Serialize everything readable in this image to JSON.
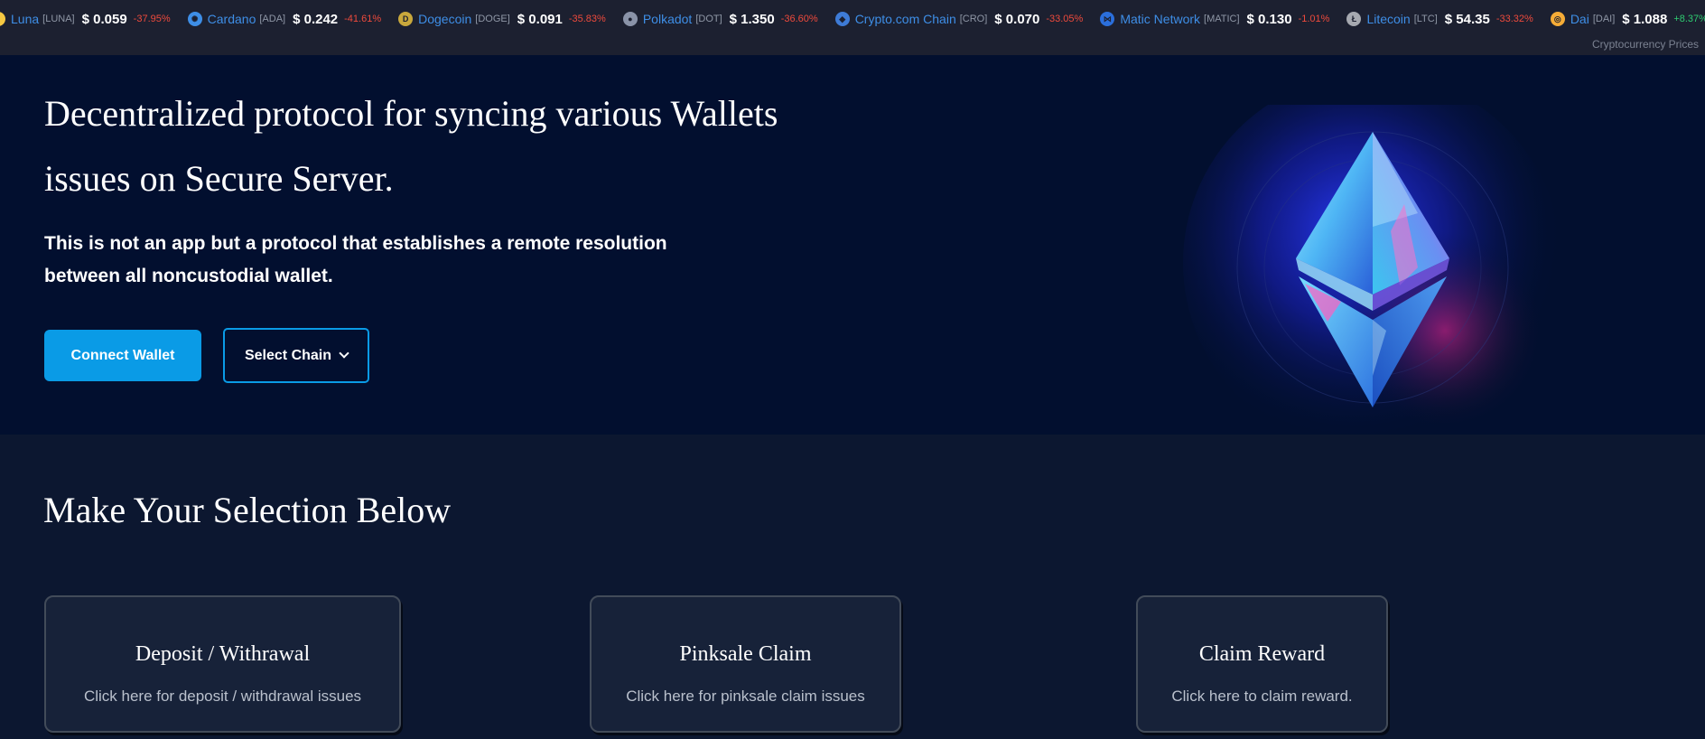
{
  "ticker": {
    "items": [
      {
        "name": "Luna",
        "symbol": "[LUNA]",
        "price": "$ 0.059",
        "change": "-37.95%",
        "dir": "neg",
        "icon": "luna-logo-icon",
        "color": "#f5c842",
        "glyph": ""
      },
      {
        "name": "Cardano",
        "symbol": "[ADA]",
        "price": "$ 0.242",
        "change": "-41.61%",
        "dir": "neg",
        "icon": "cardano-logo-icon",
        "color": "#3e8ee6",
        "glyph": "✺"
      },
      {
        "name": "Dogecoin",
        "symbol": "[DOGE]",
        "price": "$ 0.091",
        "change": "-35.83%",
        "dir": "neg",
        "icon": "dogecoin-logo-icon",
        "color": "#c9a83c",
        "glyph": "D"
      },
      {
        "name": "Polkadot",
        "symbol": "[DOT]",
        "price": "$ 1.350",
        "change": "-36.60%",
        "dir": "neg",
        "icon": "polkadot-logo-icon",
        "color": "#8a93a8",
        "glyph": "●"
      },
      {
        "name": "Crypto.com Chain",
        "symbol": "[CRO]",
        "price": "$ 0.070",
        "change": "-33.05%",
        "dir": "neg",
        "icon": "cronos-logo-icon",
        "color": "#3e7bd6",
        "glyph": "◆"
      },
      {
        "name": "Matic Network",
        "symbol": "[MATIC]",
        "price": "$ 0.130",
        "change": "-1.01%",
        "dir": "neg",
        "icon": "polygon-logo-icon",
        "color": "#2b6fdc",
        "glyph": "⋈"
      },
      {
        "name": "Litecoin",
        "symbol": "[LTC]",
        "price": "$ 54.35",
        "change": "-33.32%",
        "dir": "neg",
        "icon": "litecoin-logo-icon",
        "color": "#a6a9b0",
        "glyph": "Ł"
      },
      {
        "name": "Dai",
        "symbol": "[DAI]",
        "price": "$ 1.088",
        "change": "+8.37%",
        "dir": "pos",
        "icon": "dai-logo-icon",
        "color": "#f5ac37",
        "glyph": "◎"
      }
    ],
    "credit": "Cryptocurrency Prices"
  },
  "hero": {
    "title": "Decentralized protocol for syncing various Wallets issues on Secure Server.",
    "subtitle": "This is not an app but a protocol that establishes a remote resolution between all noncustodial wallet.",
    "connect_label": "Connect Wallet",
    "chain_label": "Select Chain",
    "illustration_icon": "ethereum-crystal-icon"
  },
  "selection": {
    "heading": "Make Your Selection Below",
    "cards": [
      {
        "title": "Deposit / Withrawal",
        "desc": "Click here for deposit / withdrawal issues"
      },
      {
        "title": "Pinksale Claim",
        "desc": "Click here for pinksale claim issues"
      },
      {
        "title": "Claim Reward",
        "desc": "Click here to claim reward."
      }
    ]
  },
  "colors": {
    "accent": "#0a9be6",
    "hero_bg": "#020f2f",
    "section_bg": "#0c1730",
    "card_bg": "#172239"
  }
}
